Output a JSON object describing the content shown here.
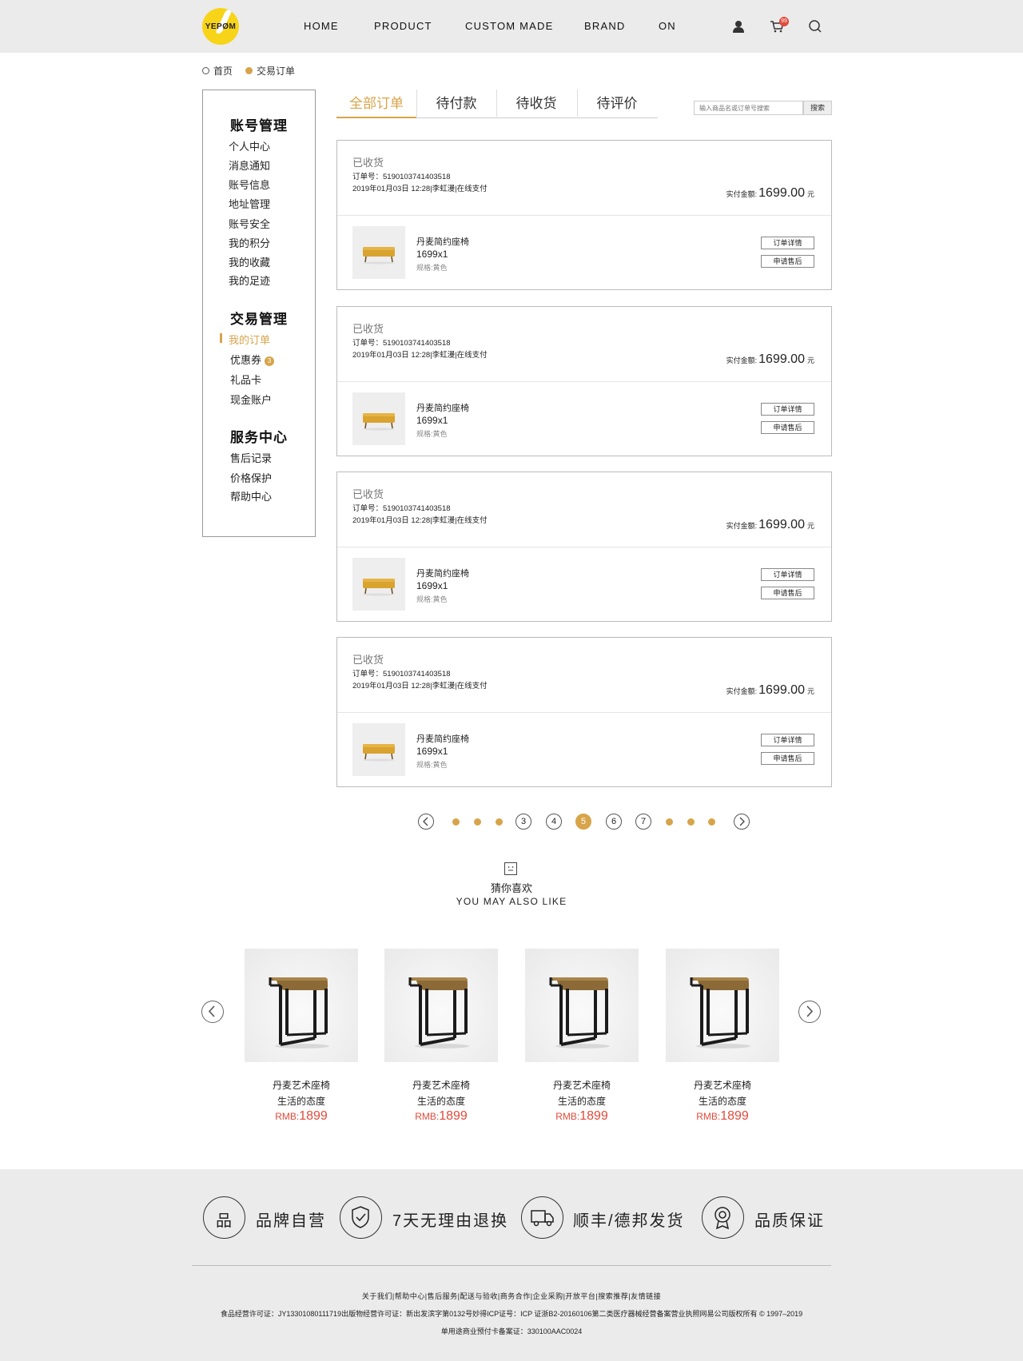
{
  "header": {
    "logo_text": "YEPØM",
    "nav": [
      "HOME",
      "PRODUCT",
      "CUSTOM MADE",
      "BRAND",
      "ON"
    ],
    "cart_count": "99"
  },
  "breadcrumb": [
    "首页",
    "交易订单"
  ],
  "sidebar": {
    "sections": [
      {
        "title": "账号管理",
        "items": [
          "个人中心",
          "消息通知",
          "账号信息",
          "地址管理",
          "账号安全",
          "我的积分",
          "我的收藏",
          "我的足迹"
        ]
      },
      {
        "title": "交易管理",
        "items": [
          "我的订单",
          "优惠券",
          "礼品卡",
          "现金账户"
        ]
      },
      {
        "title": "服务中心",
        "items": [
          "售后记录",
          "价格保护",
          "帮助中心"
        ]
      }
    ],
    "active_item": "我的订单",
    "coupon_badge": "3"
  },
  "tabs": [
    "全部订单",
    "待付款",
    "待收货",
    "待评价"
  ],
  "search": {
    "placeholder": "输入商品名或订单号搜索",
    "button": "搜索"
  },
  "orders": [
    {
      "status": "已收货",
      "order_no": "订单号：5190103741403518",
      "date": "2019年01月03日  12:28|李虹漫|在线支付",
      "paid_label": "实付金额:",
      "amount": "1699.00",
      "unit": "元",
      "product": "丹麦简约座椅",
      "qty": "1699x1",
      "spec": "规格:黄色",
      "btn_detail": "订单详情",
      "btn_after": "申请售后"
    },
    {
      "status": "已收货",
      "order_no": "订单号：5190103741403518",
      "date": "2019年01月03日  12:28|李虹漫|在线支付",
      "paid_label": "实付金额:",
      "amount": "1699.00",
      "unit": "元",
      "product": "丹麦简约座椅",
      "qty": "1699x1",
      "spec": "规格:黄色",
      "btn_detail": "订单详情",
      "btn_after": "申请售后"
    },
    {
      "status": "已收货",
      "order_no": "订单号：5190103741403518",
      "date": "2019年01月03日  12:28|李虹漫|在线支付",
      "paid_label": "实付金额:",
      "amount": "1699.00",
      "unit": "元",
      "product": "丹麦简约座椅",
      "qty": "1699x1",
      "spec": "规格:黄色",
      "btn_detail": "订单详情",
      "btn_after": "申请售后"
    },
    {
      "status": "已收货",
      "order_no": "订单号：5190103741403518",
      "date": "2019年01月03日  12:28|李虹漫|在线支付",
      "paid_label": "实付金额:",
      "amount": "1699.00",
      "unit": "元",
      "product": "丹麦简约座椅",
      "qty": "1699x1",
      "spec": "规格:黄色",
      "btn_detail": "订单详情",
      "btn_after": "申请售后"
    }
  ],
  "pagination": {
    "pages": [
      "3",
      "4",
      "5",
      "6",
      "7"
    ],
    "current": "5"
  },
  "recommend": {
    "title_cn": "猜你喜欢",
    "title_en": "YOU MAY ALSO LIKE",
    "items": [
      {
        "name": "丹麦艺术座椅",
        "slogan": "生活的态度",
        "currency": "RMB:",
        "price": "1899"
      },
      {
        "name": "丹麦艺术座椅",
        "slogan": "生活的态度",
        "currency": "RMB:",
        "price": "1899"
      },
      {
        "name": "丹麦艺术座椅",
        "slogan": "生活的态度",
        "currency": "RMB:",
        "price": "1899"
      },
      {
        "name": "丹麦艺术座椅",
        "slogan": "生活的态度",
        "currency": "RMB:",
        "price": "1899"
      }
    ]
  },
  "features": [
    {
      "icon_char": "品",
      "label": "品牌自营"
    },
    {
      "icon_char": "",
      "label": "7天无理由退换"
    },
    {
      "icon_char": "",
      "label": "顺丰/德邦发货"
    },
    {
      "icon_char": "",
      "label": "品质保证"
    }
  ],
  "footer": {
    "links": "关于我们|帮助中心|售后服务|配送与验收|商务合作|企业采购|开放平台|搜索推荐|友情链接",
    "license": "食品经营许可证：JY13301080111719出版物经营许可证：新出发滨字第0132号妙得ICP证号：ICP 证浙B2-20160106第二类医疗器械经营备案营业执照网易公司版权所有 © 1997–2019",
    "record": "单用途商业预付卡备案证：330100AAC0024"
  },
  "colors": {
    "accent": "#d7a44a",
    "price": "#e04a3a",
    "logo": "#f7d418",
    "header_bg": "#ebebeb"
  }
}
